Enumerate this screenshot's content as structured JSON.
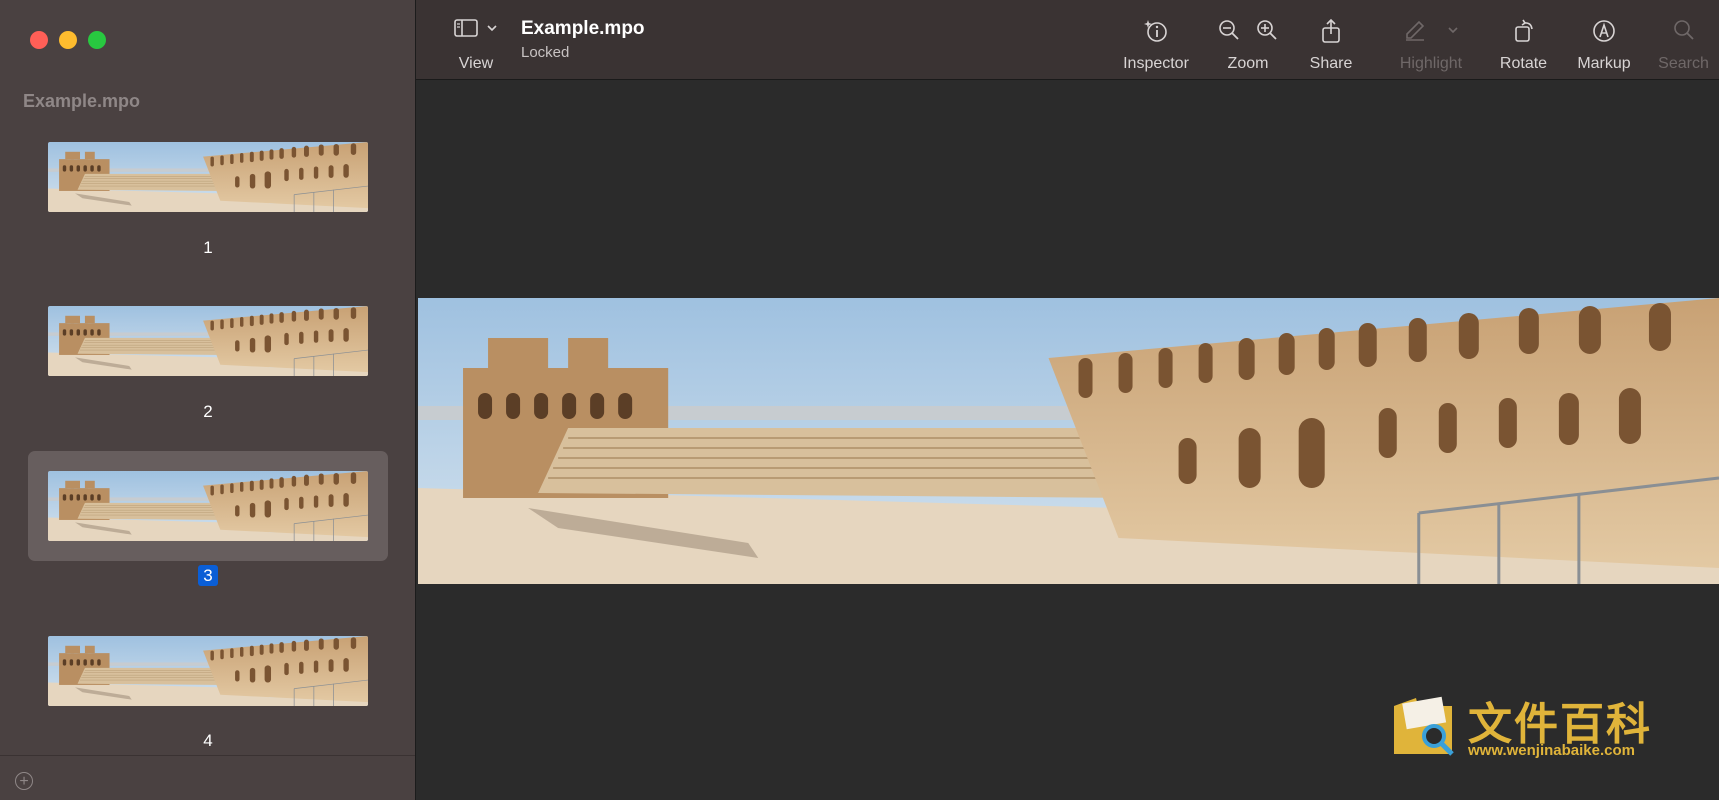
{
  "window": {
    "traffic_lights": {
      "close": "#ff5f57",
      "minimize": "#febc2e",
      "maximize": "#28c840"
    }
  },
  "sidebar": {
    "title": "Example.mpo",
    "pages": [
      {
        "label": "1",
        "selected": false
      },
      {
        "label": "2",
        "selected": false
      },
      {
        "label": "3",
        "selected": true
      },
      {
        "label": "4",
        "selected": false
      }
    ],
    "add_icon": "plus-circle-icon"
  },
  "toolbar": {
    "view_label": "View",
    "doc_title": "Example.mpo",
    "doc_status": "Locked",
    "inspector_label": "Inspector",
    "zoom_label": "Zoom",
    "share_label": "Share",
    "highlight_label": "Highlight",
    "rotate_label": "Rotate",
    "markup_label": "Markup",
    "search_label": "Search"
  },
  "watermark": {
    "text": "文件百科",
    "url": "www.wenjinabaike.com"
  },
  "colors": {
    "sidebar_bg": "#4a4141",
    "toolbar_bg": "#3a3333",
    "content_bg": "#2b2b2b",
    "selection": "#0a5ed6",
    "watermark": "#e0b43a"
  }
}
